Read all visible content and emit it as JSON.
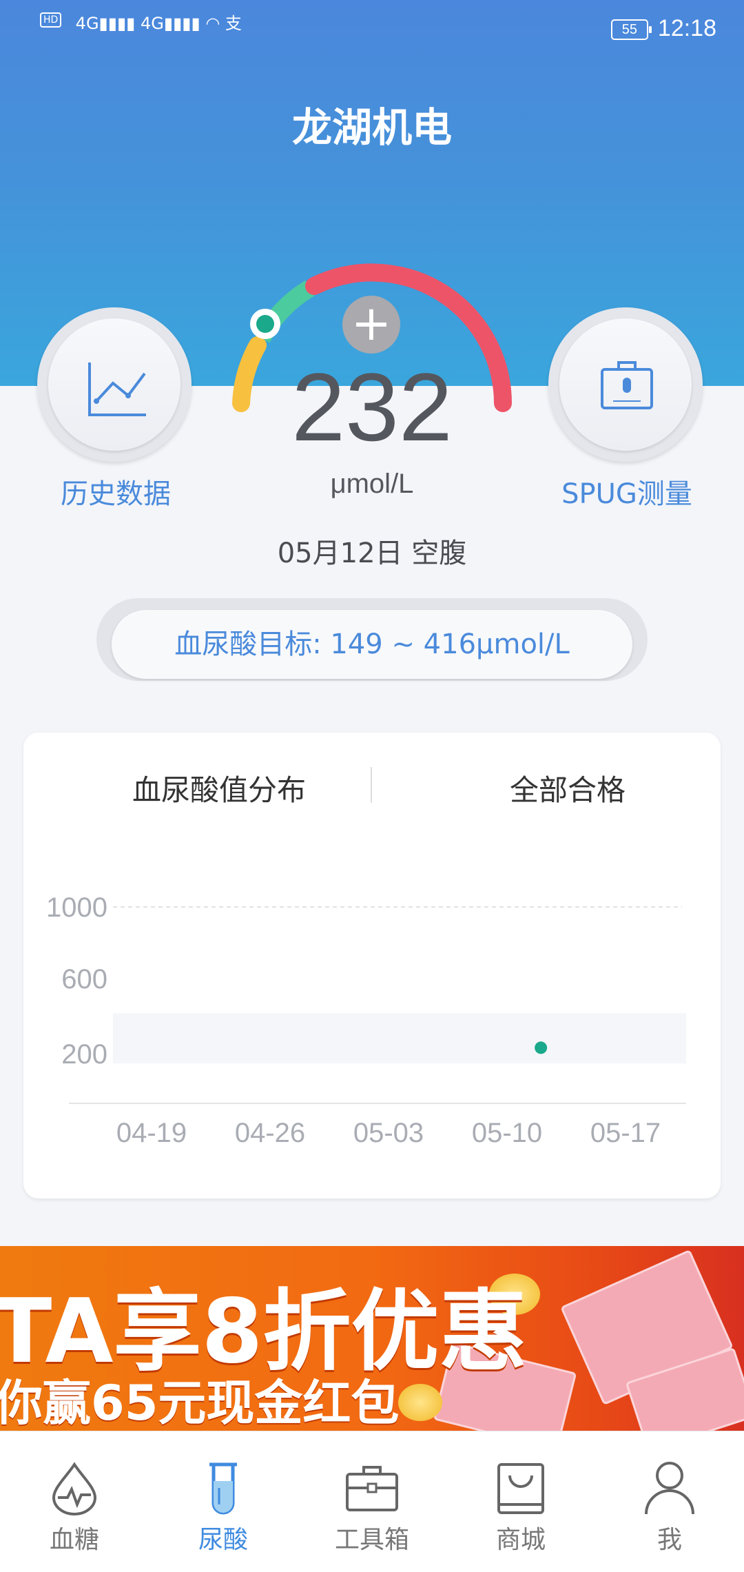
{
  "status_bar": {
    "left_indicators": "HD 4G 4G",
    "battery": "55",
    "time": "12:18"
  },
  "header": {
    "title": "龙湖机电"
  },
  "gauge": {
    "value": "232",
    "unit": "μmol/L",
    "date": "05月12日 空腹",
    "add_icon": "plus-icon"
  },
  "left_button": {
    "label": "历史数据",
    "icon": "line-chart-icon"
  },
  "right_button": {
    "label": "SPUG测量",
    "icon": "device-icon"
  },
  "target": {
    "text": "血尿酸目标: 149 ~ 416μmol/L"
  },
  "card": {
    "tab_left": "血尿酸值分布",
    "tab_right": "全部合格"
  },
  "chart_data": {
    "type": "scatter",
    "x_ticks": [
      "04-19",
      "04-26",
      "05-03",
      "05-10",
      "05-17"
    ],
    "y_ticks": [
      "1000",
      "600",
      "200"
    ],
    "ylim": [
      0,
      1000
    ],
    "target_band": [
      149,
      416
    ],
    "points": [
      {
        "x": "05-12",
        "y": 232
      }
    ],
    "colors": {
      "point": "#1aa98a",
      "band": "#f4f6f9"
    }
  },
  "banner": {
    "line1": "TA享8折优惠",
    "line2": "你赢65元现金红包"
  },
  "tabbar": [
    {
      "label": "血糖",
      "icon": "blood-drop-icon",
      "active": false
    },
    {
      "label": "尿酸",
      "icon": "test-tube-icon",
      "active": true
    },
    {
      "label": "工具箱",
      "icon": "toolbox-icon",
      "active": false
    },
    {
      "label": "商城",
      "icon": "shopping-bag-icon",
      "active": false
    },
    {
      "label": "我",
      "icon": "person-icon",
      "active": false
    }
  ]
}
